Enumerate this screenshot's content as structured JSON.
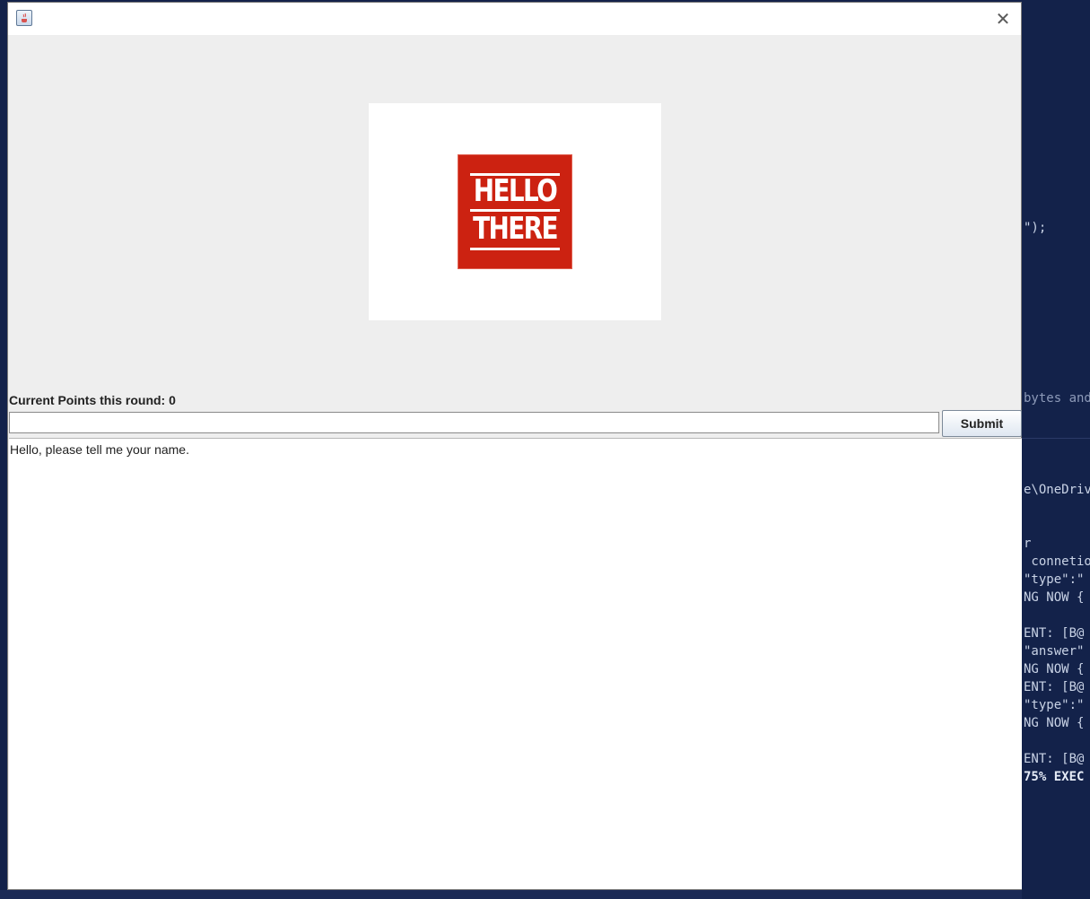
{
  "window": {
    "title": "",
    "close_glyph": "✕",
    "app_icon": "java-icon"
  },
  "image": {
    "line1": "HELLO",
    "line2": "THERE",
    "bg_color": "#cc2211"
  },
  "points_label": "Current Points this round: 0",
  "input": {
    "value": "",
    "placeholder": ""
  },
  "submit_label": "Submit",
  "log": {
    "lines": [
      "Hello, please tell me your name."
    ]
  },
  "background_ide": {
    "lines": [
      "\");",
      "bytes and",
      "e\\OneDriv",
      "r",
      " connetio",
      "\"type\":\"",
      "NG NOW {",
      "ENT: [B@",
      "\"answer\"",
      "NG NOW {",
      "ENT: [B@",
      "\"type\":\"",
      "NG NOW {",
      "ENT: [B@",
      "75% EXEC"
    ]
  }
}
